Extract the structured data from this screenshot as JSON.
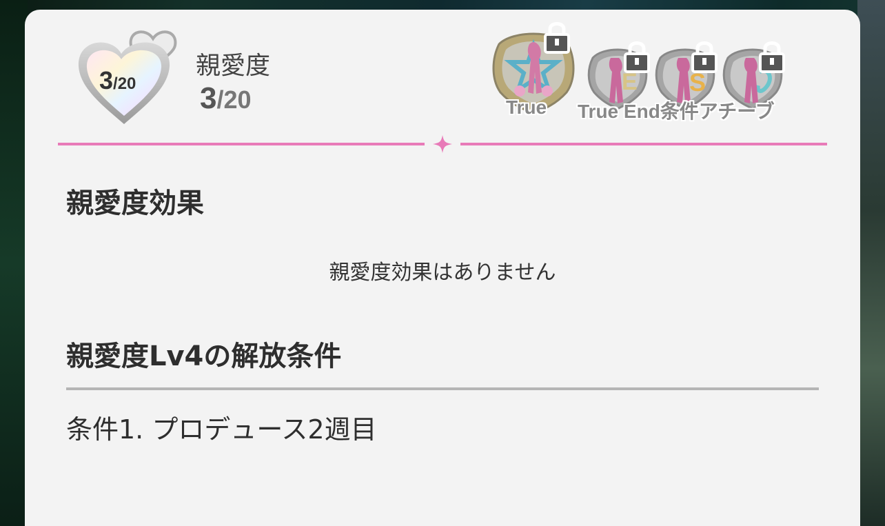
{
  "affection": {
    "badge_current": "3",
    "badge_max": "/20",
    "title": "親愛度",
    "current": "3",
    "separator": "/",
    "max": "20"
  },
  "achievements": {
    "label_1": "True",
    "label_2": "True End条件アチーブ",
    "lock_icon": "lock-icon"
  },
  "effect_section": {
    "title": "親愛度効果",
    "empty_message": "親愛度効果はありません"
  },
  "unlock_section": {
    "title": "親愛度Lv4の解放条件",
    "conditions": [
      "条件1.  プロデュース2週目"
    ]
  },
  "colors": {
    "accent_pink": "#e87ab8",
    "panel_bg": "#f3f3f3"
  }
}
